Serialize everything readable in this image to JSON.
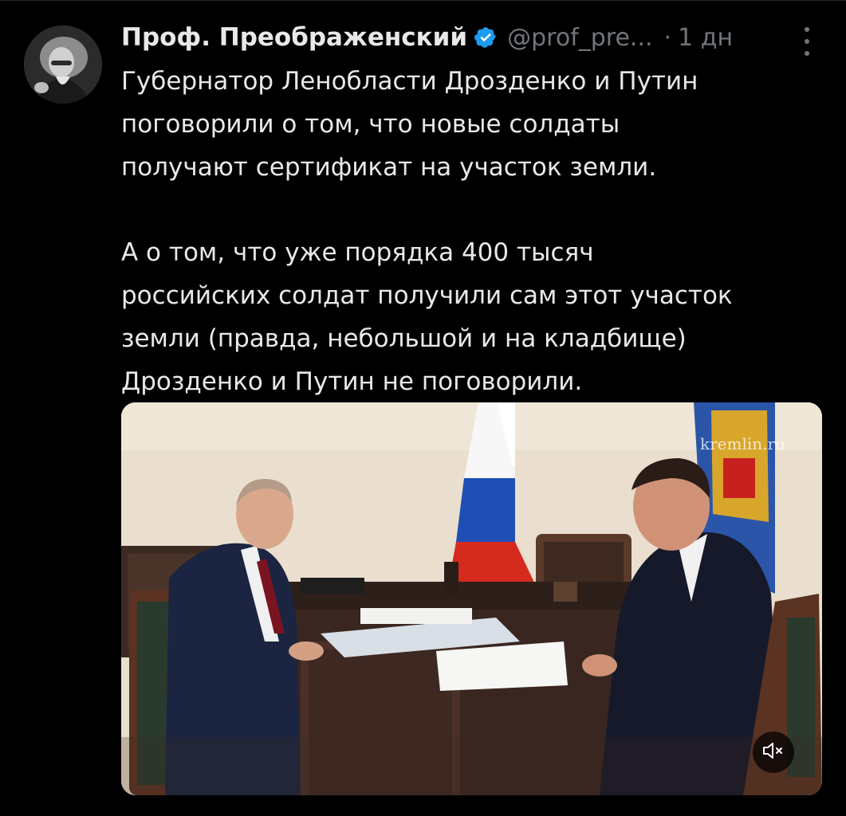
{
  "tweet": {
    "author": {
      "display_name": "Проф. Преображенский",
      "handle": "@prof_pre...",
      "verified": true
    },
    "separator": "·",
    "time": "1 дн",
    "text": "Губернатор Ленобласти Дрозденко и Путин\nпоговорили о том, что новые солдаты\nполучают сертификат на участок земли.\n\nА о том, что уже порядка 400 тысяч\nроссийских солдат получили сам этот участок\nземли (правда, небольшой и на кладбище)\nДрозденко и Путин не поговорили.",
    "media": {
      "watermark": "kremlin.ru",
      "mute_icon": "volume-muted-icon"
    }
  },
  "colors": {
    "background": "#000000",
    "text_primary": "#e7e9ea",
    "text_secondary": "#71767b",
    "verified": "#1d9bf0"
  }
}
